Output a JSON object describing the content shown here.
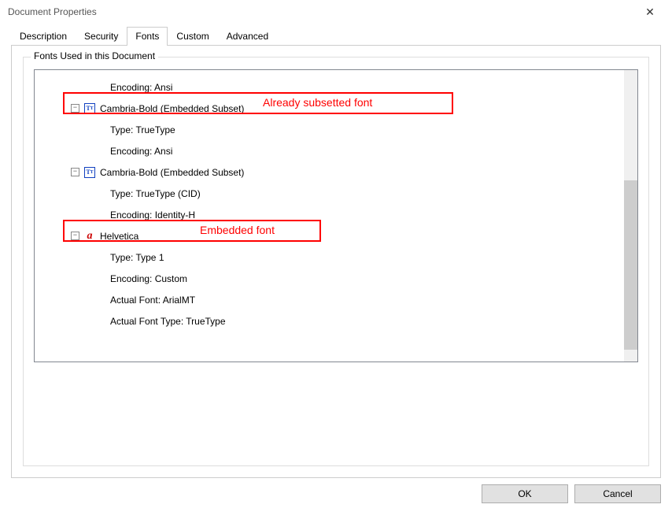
{
  "window": {
    "title": "Document Properties",
    "close_glyph": "✕"
  },
  "tabs": {
    "description": "Description",
    "security": "Security",
    "fonts": "Fonts",
    "custom": "Custom",
    "advanced": "Advanced",
    "active": "fonts"
  },
  "group": {
    "label": "Fonts Used in this Document"
  },
  "tree": {
    "rows": [
      {
        "kind": "detail",
        "text": "Encoding: Ansi"
      },
      {
        "kind": "font",
        "expander": "-",
        "icon": "tt",
        "text": "Cambria-Bold (Embedded Subset)"
      },
      {
        "kind": "detail",
        "text": "Type: TrueType"
      },
      {
        "kind": "detail",
        "text": "Encoding: Ansi"
      },
      {
        "kind": "font",
        "expander": "-",
        "icon": "tt",
        "text": "Cambria-Bold (Embedded Subset)"
      },
      {
        "kind": "detail",
        "text": "Type: TrueType (CID)"
      },
      {
        "kind": "detail",
        "text": "Encoding: Identity-H"
      },
      {
        "kind": "font",
        "expander": "-",
        "icon": "a",
        "text": "Helvetica"
      },
      {
        "kind": "detail",
        "text": "Type: Type 1"
      },
      {
        "kind": "detail",
        "text": "Encoding: Custom"
      },
      {
        "kind": "detail",
        "text": "Actual Font: ArialMT"
      },
      {
        "kind": "detail",
        "text": "Actual Font Type: TrueType"
      }
    ]
  },
  "annotations": {
    "a1": "Already subsetted font",
    "a2": "Embedded font"
  },
  "buttons": {
    "ok": "OK",
    "cancel": "Cancel"
  },
  "icon_glyphs": {
    "tt": "T",
    "a": "a",
    "minus": "−"
  }
}
